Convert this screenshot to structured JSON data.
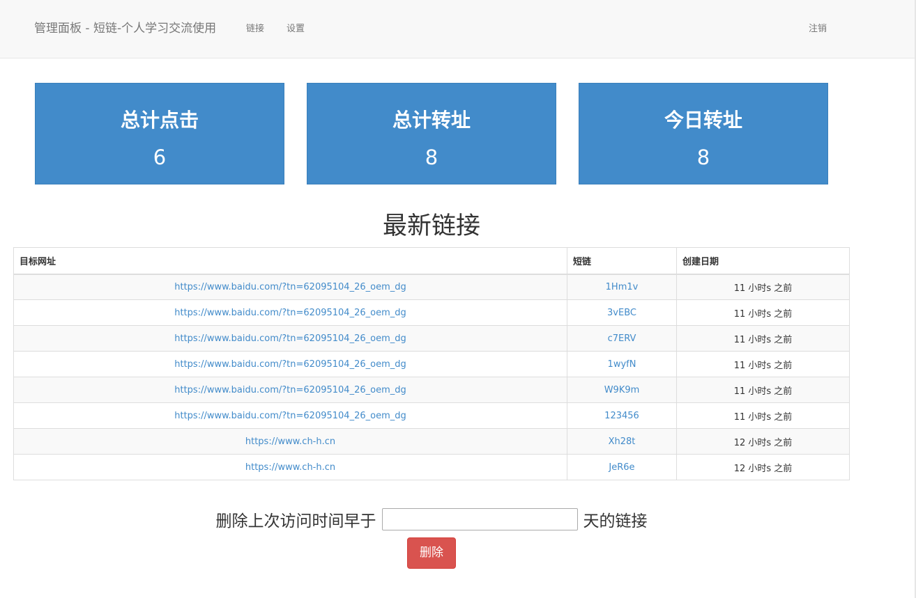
{
  "navbar": {
    "brand": "管理面板 - 短链-个人学习交流使用",
    "links": [
      "链接",
      "设置"
    ],
    "logout": "注销"
  },
  "stats": [
    {
      "title": "总计点击",
      "value": "6"
    },
    {
      "title": "总计转址",
      "value": "8"
    },
    {
      "title": "今日转址",
      "value": "8"
    }
  ],
  "section_title": "最新链接",
  "table": {
    "headers": [
      "目标网址",
      "短链",
      "创建日期"
    ],
    "rows": [
      {
        "url": "https://www.baidu.com/?tn=62095104_26_oem_dg",
        "short": "1Hm1v",
        "date": "11 小时s 之前"
      },
      {
        "url": "https://www.baidu.com/?tn=62095104_26_oem_dg",
        "short": "3vEBC",
        "date": "11 小时s 之前"
      },
      {
        "url": "https://www.baidu.com/?tn=62095104_26_oem_dg",
        "short": "c7ERV",
        "date": "11 小时s 之前"
      },
      {
        "url": "https://www.baidu.com/?tn=62095104_26_oem_dg",
        "short": "1wyfN",
        "date": "11 小时s 之前"
      },
      {
        "url": "https://www.baidu.com/?tn=62095104_26_oem_dg",
        "short": "W9K9m",
        "date": "11 小时s 之前"
      },
      {
        "url": "https://www.baidu.com/?tn=62095104_26_oem_dg",
        "short": "123456",
        "date": "11 小时s 之前"
      },
      {
        "url": "https://www.ch-h.cn",
        "short": "Xh28t",
        "date": "12 小时s 之前"
      },
      {
        "url": "https://www.ch-h.cn",
        "short": "JeR6e",
        "date": "12 小时s 之前"
      }
    ]
  },
  "delete_form": {
    "prefix": "删除上次访问时间早于",
    "suffix": "天的链接",
    "value": "",
    "button": "删除"
  },
  "colors": {
    "primary": "#428bca",
    "danger": "#d9534f",
    "navbar_bg": "#f8f8f8"
  }
}
